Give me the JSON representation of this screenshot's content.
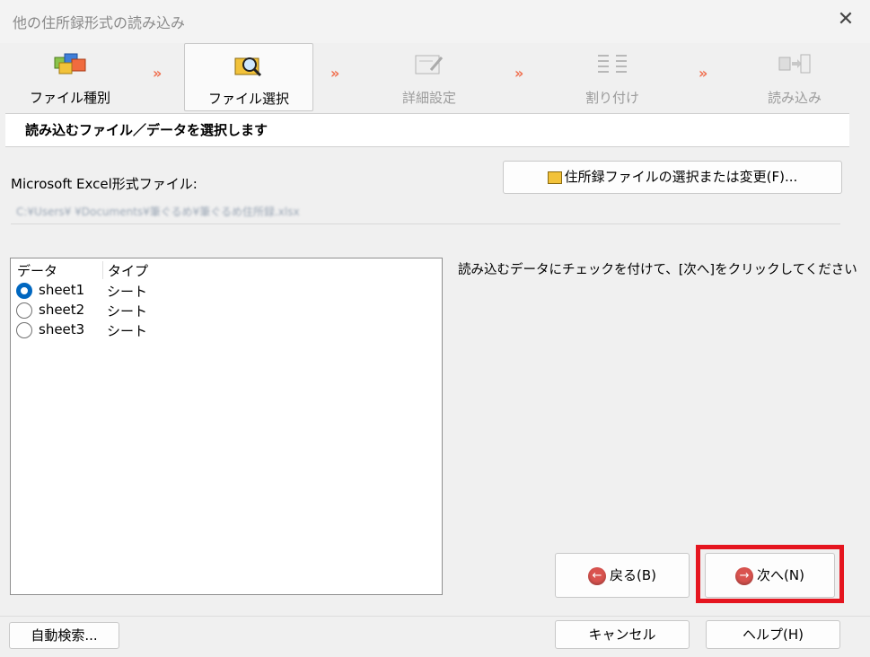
{
  "window": {
    "title": "他の住所録形式の読み込み"
  },
  "steps": [
    {
      "label": "ファイル種別",
      "icon": "folders-icon",
      "state": "done"
    },
    {
      "label": "ファイル選択",
      "icon": "folder-search-icon",
      "state": "active"
    },
    {
      "label": "詳細設定",
      "icon": "settings-tools-icon",
      "state": "disabled"
    },
    {
      "label": "割り付け",
      "icon": "mapping-icon",
      "state": "disabled"
    },
    {
      "label": "読み込み",
      "icon": "import-icon",
      "state": "disabled"
    }
  ],
  "step_separator": "»",
  "header": {
    "text": "読み込むファイル／データを選択します"
  },
  "file": {
    "label": "Microsoft Excel形式ファイル:",
    "select_button": "住所録ファイルの選択または変更(F)...",
    "path": "C:¥Users¥ ¥Documents¥筆ぐるめ¥筆ぐるめ住所録.xlsx"
  },
  "list": {
    "columns": [
      "データ",
      "タイプ"
    ],
    "rows": [
      {
        "name": "sheet1",
        "type": "シート",
        "selected": true
      },
      {
        "name": "sheet2",
        "type": "シート",
        "selected": false
      },
      {
        "name": "sheet3",
        "type": "シート",
        "selected": false
      }
    ]
  },
  "hint": "読み込むデータにチェックを付けて、[次へ]をクリックしてください",
  "buttons": {
    "back": "戻る(B)",
    "next": "次へ(N)",
    "auto_search": "自動検索...",
    "cancel": "キャンセル",
    "help": "ヘルプ(H)"
  },
  "colors": {
    "highlight": "#e5151f",
    "radio_selected": "#0067c0",
    "chevron": "#f07050"
  }
}
